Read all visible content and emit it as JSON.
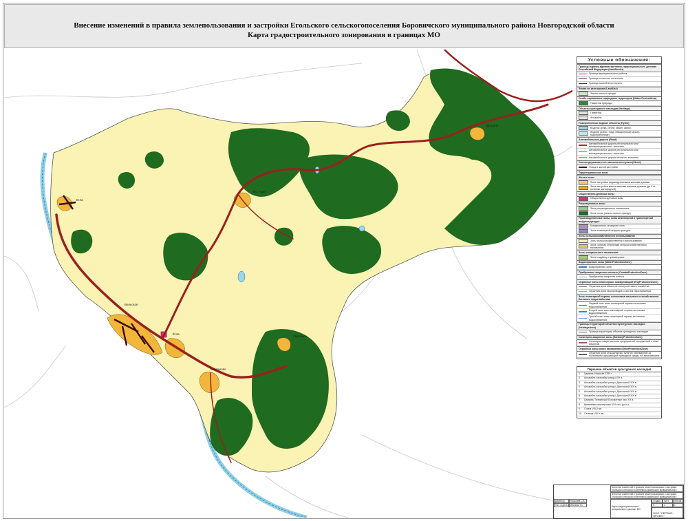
{
  "header": {
    "title_line1": "Внесение изменений в правила землепользования и застройки Егольского сельскогопоселения Боровичского муниципального района Новгородской области",
    "title_line2": "Карта градостроительного зонирования в границах МО"
  },
  "colors": {
    "forest": "#1f6b1f",
    "residential": "#fbf3b3",
    "road": "#9c1f1f",
    "water": "#9fd6e8",
    "settlement": "#f1b63a",
    "public": "#d6337a"
  },
  "map": {
    "settlement_labels": [
      "Егла",
      "Бельское",
      "Шегрино",
      "Ёгла",
      "Бл. Горы",
      "Зарубино",
      "Бакланово"
    ]
  },
  "legend": {
    "title": "Условные обозначения:",
    "sections": [
      {
        "title": "Границы единиц административно-территориального деления Российской Федерации (AdmBorder)",
        "items": [
          {
            "label": "Граница муниципального района",
            "kind": "line",
            "color": "#b0194a"
          },
          {
            "label": "Граница сельского поселения",
            "kind": "line",
            "color": "#7a2c8a"
          },
          {
            "label": "Граница населённого пункта",
            "kind": "line",
            "color": "#333333"
          }
        ]
      },
      {
        "title": "Земли по категориям (LandUse)",
        "items": [
          {
            "label": "Земли лесного фонда",
            "kind": "box",
            "color": "#cde8c6"
          }
        ]
      },
      {
        "title": "Особо охраняемые природные территории (NatureProtectArea)",
        "items": [
          {
            "label": "Памятник природы",
            "kind": "box",
            "color": "#2d8a2d"
          }
        ]
      },
      {
        "title": "Объекты культурного наследия (Heritage)",
        "items": [
          {
            "label": "Памятник",
            "kind": "box",
            "color": "#e0e0e0"
          },
          {
            "label": "Ансамбль",
            "kind": "box",
            "color": "#e0e0e0"
          }
        ]
      },
      {
        "title": "Поверхностные водные объекты (Hydro)",
        "items": [
          {
            "label": "Водоток (река, ручей, канал, озеро)",
            "kind": "box",
            "color": "#9fd6e8"
          },
          {
            "label": "Водоем (озеро, пруд, обводненный карьер, водохранилище)",
            "kind": "box",
            "color": "#bfe6f1"
          }
        ]
      },
      {
        "title": "Автомобильные дороги (Road)",
        "items": [
          {
            "label": "Автомобильные дороги регионального или межмуниципального значения",
            "kind": "line",
            "color": "#c41f1f"
          },
          {
            "label": "Автомобильные дороги регионального или межмуниципального значения",
            "kind": "line",
            "color": "#e05a5a"
          },
          {
            "label": "Автомобильные дороги местного значения",
            "kind": "line",
            "color": "#f08a8a"
          }
        ]
      },
      {
        "title": "Улично-дорожная сеть населенного пункта (Street)",
        "items": [
          {
            "label": "Улица в жилой застройке",
            "kind": "line",
            "color": "#5a1414"
          }
        ]
      },
      {
        "title": "Территориальные зоны",
        "items": []
      },
      {
        "title": "Жилые зоны",
        "items": [
          {
            "label": "Зона застройки индивидуальными жилыми домами",
            "kind": "box",
            "color": "#f6d25a"
          },
          {
            "label": "Зона застройки малоэтажными жилыми домами (до 4 эт., включая мансардный)",
            "kind": "box",
            "color": "#f1a62a"
          }
        ]
      },
      {
        "title": "Общественно-деловые зоны",
        "items": [
          {
            "label": "Общественно-деловые зоны",
            "kind": "box",
            "color": "#d6337a"
          }
        ]
      },
      {
        "title": "Рекреационные зоны",
        "items": [
          {
            "label": "Зона рекреационного назначения",
            "kind": "box",
            "color": "#8fd08f"
          },
          {
            "label": "Зона лесов (земли лесного фонда)",
            "kind": "box",
            "color": "#1f6b1f"
          }
        ]
      },
      {
        "title": "Производственные зоны, зоны инженерной и транспортной инфраструктуры",
        "items": [
          {
            "label": "Коммунально-складская зона",
            "kind": "box",
            "color": "#b48cc8"
          },
          {
            "label": "Зона инженерной инфраструктуры",
            "kind": "box",
            "color": "#8c8cc8"
          }
        ]
      },
      {
        "title": "Зоны сельскохозяйственного использования",
        "items": [
          {
            "label": "Зоны сельскохозяйственного использования",
            "kind": "box",
            "color": "#fbf3b3"
          },
          {
            "label": "Зона, занятая объектами сельскохозяйственного назначения",
            "kind": "box",
            "color": "#d8c46a"
          }
        ]
      },
      {
        "title": "Зоны специального назначения",
        "items": [
          {
            "label": "Зона кладбищ и крематориев",
            "kind": "box",
            "color": "#a5c87a"
          }
        ]
      },
      {
        "title": "Водоохранные зоны (WaterProtectionZone)",
        "items": [
          {
            "label": "Водоохранная зона",
            "kind": "line",
            "color": "#3a7bd5"
          }
        ]
      },
      {
        "title": "Прибрежные защитные полосы (CoastalProtectionZone)",
        "items": [
          {
            "label": "Прибрежная защитная полоса",
            "kind": "line",
            "color": "#5aa0e0"
          }
        ]
      },
      {
        "title": "Охранные зоны инженерных коммуникаций (EngProtectionZone)",
        "items": [
          {
            "label": "Охранная зона объектов электросетевого хозяйства",
            "kind": "line",
            "color": "#888888"
          },
          {
            "label": "Охранная зона газопроводов и систем газоснабжения",
            "kind": "line",
            "color": "#c8a040"
          }
        ]
      },
      {
        "title": "Зоны санитарной охраны источников питьевого и хозяйственно-бытового водоснабжения",
        "items": [
          {
            "label": "Первый пояс зоны санитарной охраны источника водоснабжения",
            "kind": "line",
            "color": "#2a5fa8"
          },
          {
            "label": "Второй пояс зоны санитарной охраны источника водоснабжения",
            "kind": "line",
            "color": "#4a7fc8"
          },
          {
            "label": "Третий пояс зоны санитарной охраны источника водоснабжения",
            "kind": "line",
            "color": "#6a9fe8"
          }
        ]
      },
      {
        "title": "Границы территорий объектов культурного наследия (HeritageArea)",
        "items": [
          {
            "label": "Граница территории объекта культурного наследия",
            "kind": "line",
            "color": "#7a4a1a"
          }
        ]
      },
      {
        "title": "Санитарно-защитные зоны (SanitaryProtectionZone)",
        "items": [
          {
            "label": "Санитарно-защитная зона предприятий, сооружений и иных объектов",
            "kind": "line",
            "color": "#a05a5a"
          }
        ]
      },
      {
        "title": "Охранные зоны иного назначения (OtherProtectionZone)",
        "items": [
          {
            "label": "Охранная зона стационарных пунктов наблюдений за состоянием окружающей природной среды, ее загрязнением",
            "kind": "line",
            "color": "#606060"
          }
        ]
      }
    ]
  },
  "heritage": {
    "title": "Перечень объектов культурного наследия",
    "items": [
      {
        "num": "1",
        "name": "Церковь Николая 1764 г."
      },
      {
        "num": "2",
        "name": "Ансамбль застройки улицы XIX в."
      },
      {
        "num": "3",
        "name": "Ансамбль застройки улицы. Дом жилой XIX в."
      },
      {
        "num": "4",
        "name": "Ансамбль застройки улицы. Дом жилой XIX в."
      },
      {
        "num": "5",
        "name": "Ансамбль застройки улицы. Дом жилой XIX в."
      },
      {
        "num": "6",
        "name": "Ансамбль застройки улицы. Дом жилой XIX в."
      },
      {
        "num": "7",
        "name": "Церковь Тихвинской Богоматери нач. XX в."
      },
      {
        "num": "8",
        "name": "Кремнёвая мастерская IV-II тыс. до н.э."
      },
      {
        "num": "9",
        "name": "Сопка VIII-X вв."
      },
      {
        "num": "10",
        "name": "Селище VIII-X вв."
      }
    ]
  },
  "stamp": {
    "project_line1": "Внесение изменений в правила землепользования и застройки Егольского сельского поселения Боровичского муниципального района Новгородской области",
    "project_line2": "Внесение изменений в правила землепользования и застройки Егольского сельского поселения Боровичского муниципального района Новгородской области",
    "sheet_title": "Карта градостроительного зонирования в границах МО",
    "company": "ООО \"СЕРВИС-ПРОЕКТ\"",
    "role1": "Директор",
    "role2": "Нач. отдела",
    "name1": "Николаев С.В.",
    "name2": "Иванова Т.С.",
    "sheet_label": "Лист",
    "sheets_label": "Листов",
    "stage_label": "Стадия",
    "stage_value": "П",
    "sheet_value": "1",
    "sheets_value": "1"
  }
}
